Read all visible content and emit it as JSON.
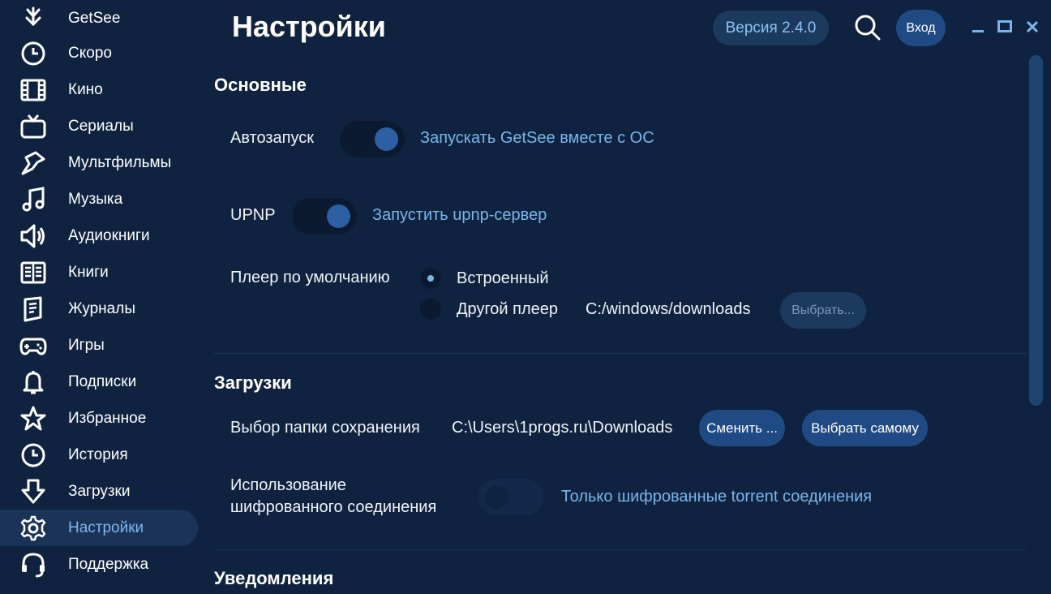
{
  "sidebar": {
    "items": [
      {
        "label": "GetSee",
        "icon": "getsee-logo-icon",
        "active": false
      },
      {
        "label": "Скоро",
        "icon": "clock-icon",
        "active": false
      },
      {
        "label": "Кино",
        "icon": "film-icon",
        "active": false
      },
      {
        "label": "Сериалы",
        "icon": "tv-icon",
        "active": false
      },
      {
        "label": "Мультфильмы",
        "icon": "cartoon-icon",
        "active": false
      },
      {
        "label": "Музыка",
        "icon": "music-note-icon",
        "active": false
      },
      {
        "label": "Аудиокниги",
        "icon": "speaker-icon",
        "active": false
      },
      {
        "label": "Книги",
        "icon": "book-icon",
        "active": false
      },
      {
        "label": "Журналы",
        "icon": "magazine-icon",
        "active": false
      },
      {
        "label": "Игры",
        "icon": "gamepad-icon",
        "active": false
      },
      {
        "label": "Подписки",
        "icon": "bell-icon",
        "active": false
      },
      {
        "label": "Избранное",
        "icon": "star-icon",
        "active": false
      },
      {
        "label": "История",
        "icon": "history-clock-icon",
        "active": false
      },
      {
        "label": "Загрузки",
        "icon": "download-arrow-icon",
        "active": false
      },
      {
        "label": "Настройки",
        "icon": "gear-icon",
        "active": true
      },
      {
        "label": "Поддержка",
        "icon": "headset-icon",
        "active": false
      }
    ]
  },
  "header": {
    "title": "Настройки",
    "version": "Версия 2.4.0",
    "login": "Вход"
  },
  "sections": {
    "main": {
      "title": "Основные",
      "autostart": {
        "label": "Автозапуск",
        "link": "Запускать GetSee вместе с ОС",
        "on": true
      },
      "upnp": {
        "label": "UPNP",
        "link": "Запустить upnp-сервер",
        "on": true
      },
      "player": {
        "label": "Плеер по умолчанию",
        "builtin": "Встроенный",
        "other": "Другой плеер",
        "path": "C:/windows/downloads",
        "choose": "Выбрать...",
        "selected": "builtin"
      }
    },
    "downloads": {
      "title": "Загрузки",
      "folder_label": "Выбор папки сохранения",
      "folder_path": "C:\\Users\\1progs.ru\\Downloads",
      "change": "Сменить ...",
      "choose_self": "Выбрать самому",
      "encryption_label_1": "Использование",
      "encryption_label_2": "шифрованного соединения",
      "encryption_link": "Только шифрованные torrent соединения",
      "encryption_on": false
    },
    "notifications": {
      "title": "Уведомления"
    }
  },
  "colors": {
    "background": "#0f2340",
    "accent": "#78b6ea",
    "button": "#1f4a84"
  }
}
